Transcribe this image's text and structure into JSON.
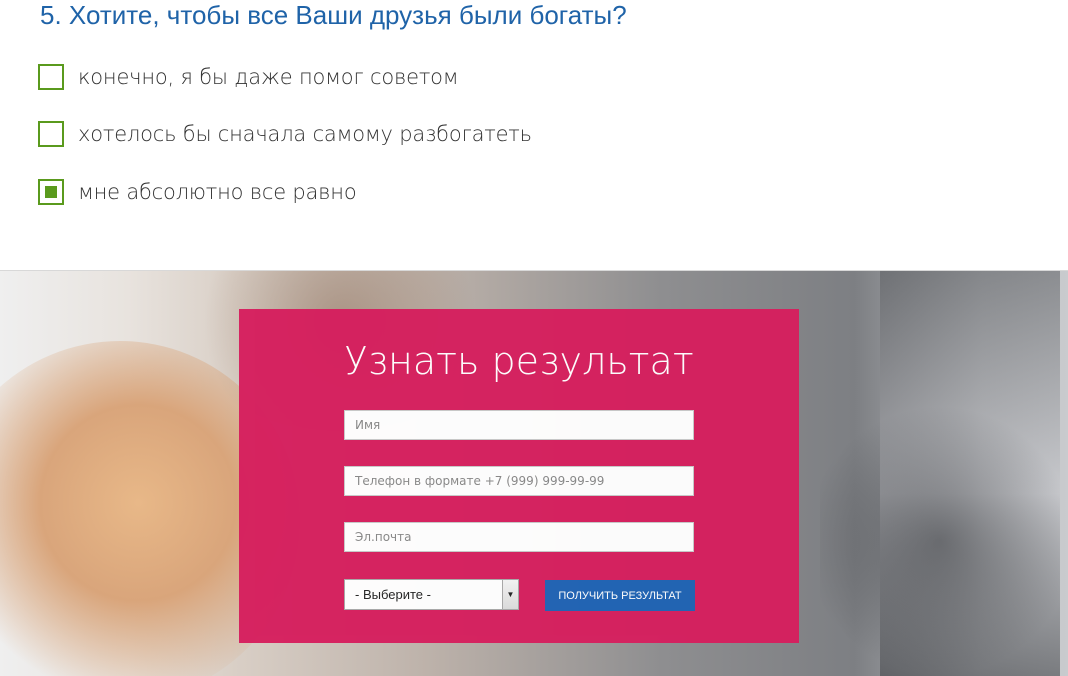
{
  "question": {
    "title": "5. Хотите, чтобы все Ваши друзья были богаты?",
    "options": [
      {
        "label": "конечно, я бы даже помог советом",
        "checked": false
      },
      {
        "label": "хотелось бы сначала самому разбогатеть",
        "checked": false
      },
      {
        "label": "мне абсолютно все равно",
        "checked": true
      }
    ]
  },
  "form": {
    "title": "Узнать результат",
    "name_placeholder": "Имя",
    "phone_placeholder": "Телефон в формате +7 (999) 999-99-99",
    "email_placeholder": "Эл.почта",
    "select_value": "- Выберите -",
    "submit_label": "ПОЛУЧИТЬ РЕЗУЛЬТАТ"
  },
  "colors": {
    "accent_blue": "#1f63a8",
    "checkbox_green": "#5a9a1d",
    "panel_pink": "#d61f5e",
    "button_blue": "#1f63b4"
  }
}
